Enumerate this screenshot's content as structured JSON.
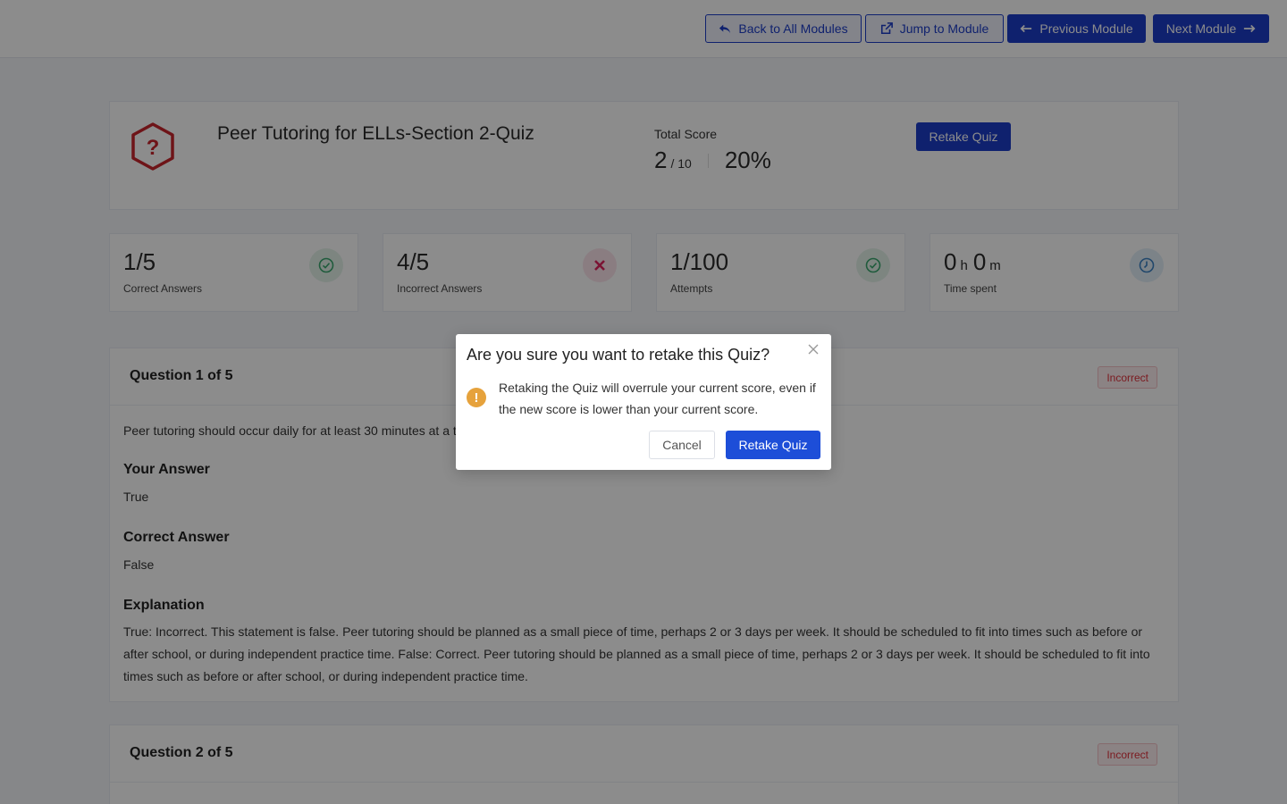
{
  "nav": {
    "back_label": "Back to All Modules",
    "jump_label": "Jump to Module",
    "prev_label": "Previous Module",
    "next_label": "Next Module"
  },
  "quiz": {
    "title": "Peer Tutoring for ELLs-Section 2-Quiz",
    "score_label": "Total Score",
    "score": "2",
    "score_max": "/ 10",
    "percent": "20%",
    "retake_label": "Retake Quiz"
  },
  "stats": [
    {
      "value": "1/5",
      "label": "Correct Answers",
      "icon": "check-circle-icon",
      "color": "#3aa76d"
    },
    {
      "value": "4/5",
      "label": "Incorrect Answers",
      "icon": "x-icon",
      "color": "#e0245e"
    },
    {
      "value": "1/100",
      "label": "Attempts",
      "icon": "check-circle-icon",
      "color": "#3aa76d"
    },
    {
      "hours": "0",
      "hours_unit": "h",
      "minutes": "0",
      "minutes_unit": "m",
      "label": "Time spent",
      "icon": "clock-icon",
      "color": "#3b82c4"
    }
  ],
  "questions": [
    {
      "title": "Question 1 of 5",
      "status": "Incorrect",
      "text": "Peer tutoring should occur daily for at least 30 minutes at a t",
      "your_answer_label": "Your Answer",
      "your_answer": "True",
      "correct_answer_label": "Correct Answer",
      "correct_answer": "False",
      "explanation_label": "Explanation",
      "explanation": "True: Incorrect. This statement is false. Peer tutoring should be planned as a small piece of time, perhaps 2 or 3 days per week. It should be scheduled to fit into times such as before or after school, or during independent practice time. False: Correct. Peer tutoring should be planned as a small piece of time, perhaps 2 or 3 days per week. It should be scheduled to fit into times such as before or after school, or during independent practice time."
    },
    {
      "title": "Question 2 of 5",
      "status": "Incorrect"
    }
  ],
  "modal": {
    "title": "Are you sure you want to retake this Quiz?",
    "message": "Retaking the Quiz will overrule your current score, even if the new score is lower than your current score.",
    "cancel_label": "Cancel",
    "confirm_label": "Retake Quiz",
    "warn_symbol": "!"
  }
}
